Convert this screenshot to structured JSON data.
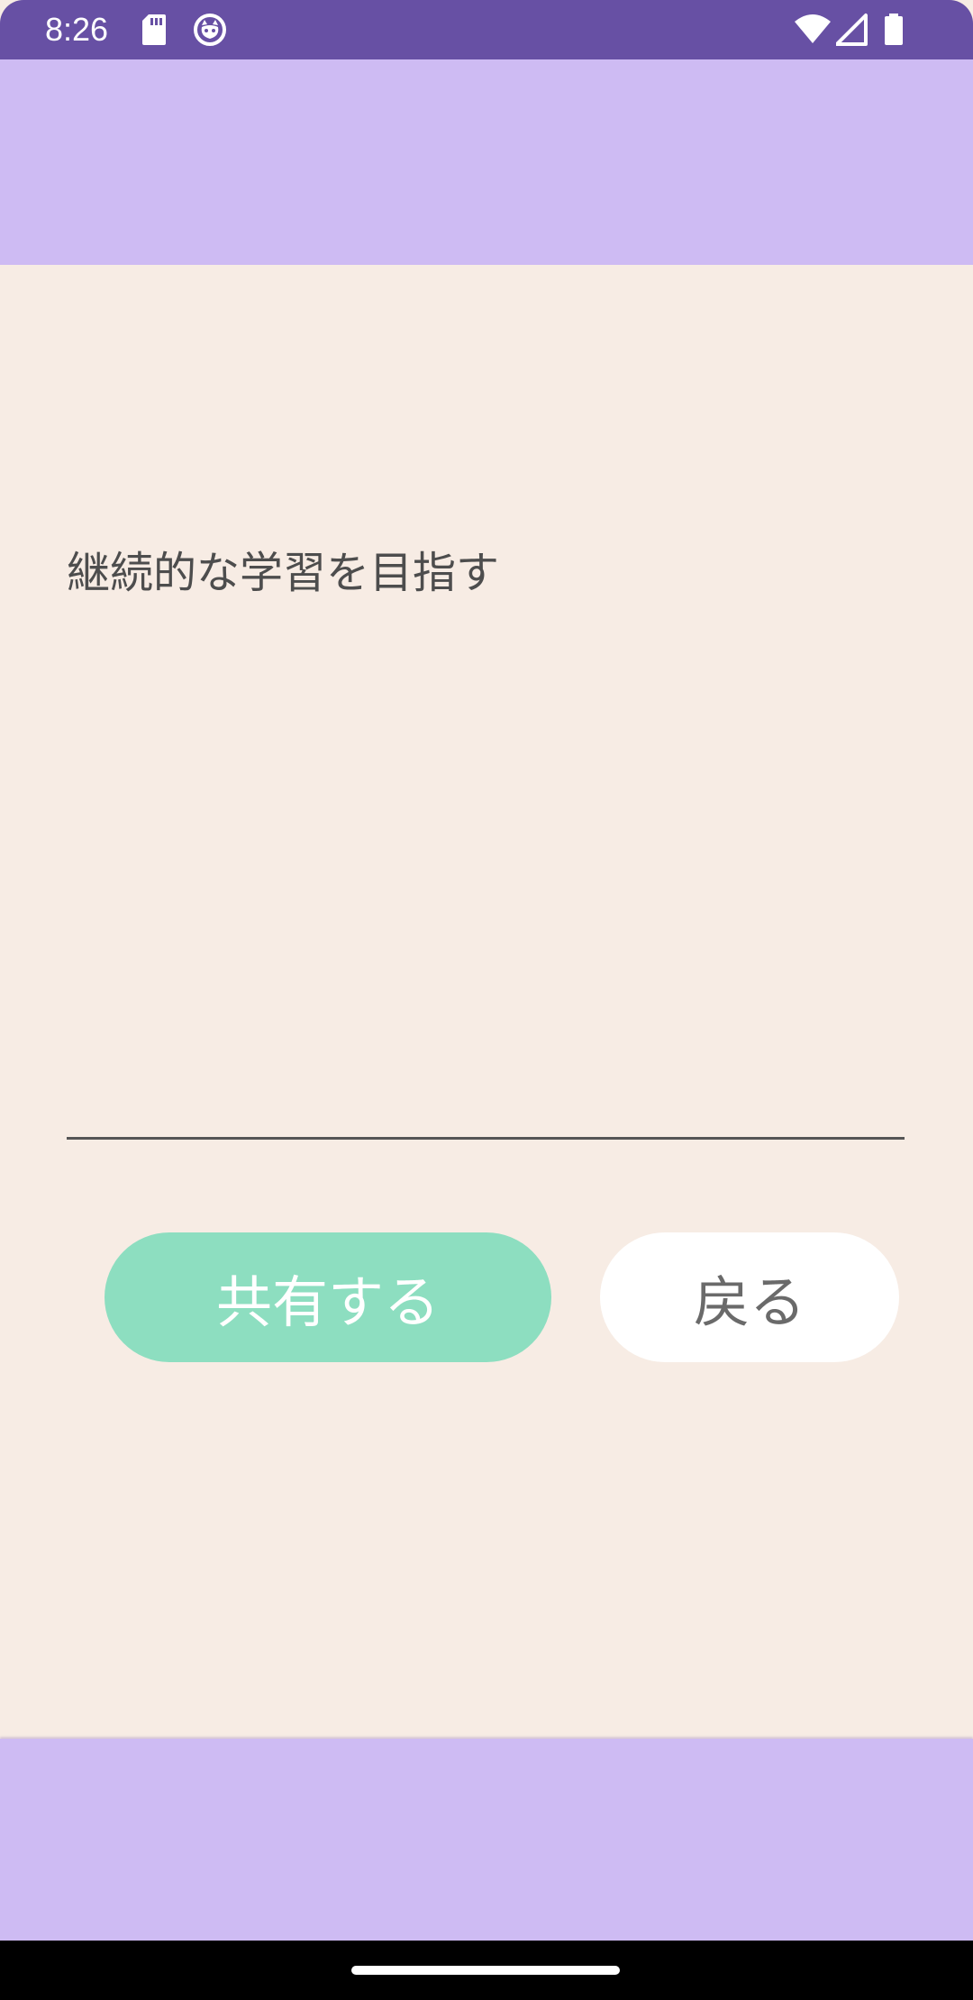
{
  "status_bar": {
    "time": "8:26",
    "icons": [
      "sd-card-icon",
      "cat-face-icon",
      "wifi-icon",
      "signal-icon",
      "battery-icon"
    ],
    "background": "#6750a4"
  },
  "main": {
    "goal_text": "継続的な学習を目指す",
    "share_button_label": "共有する",
    "back_button_label": "戻る"
  },
  "colors": {
    "app_bar": "#cebbf3",
    "content_background": "#f7ece4",
    "share_button": "#8ddec0",
    "back_button": "#ffffff",
    "navigation_bar": "#000000"
  }
}
